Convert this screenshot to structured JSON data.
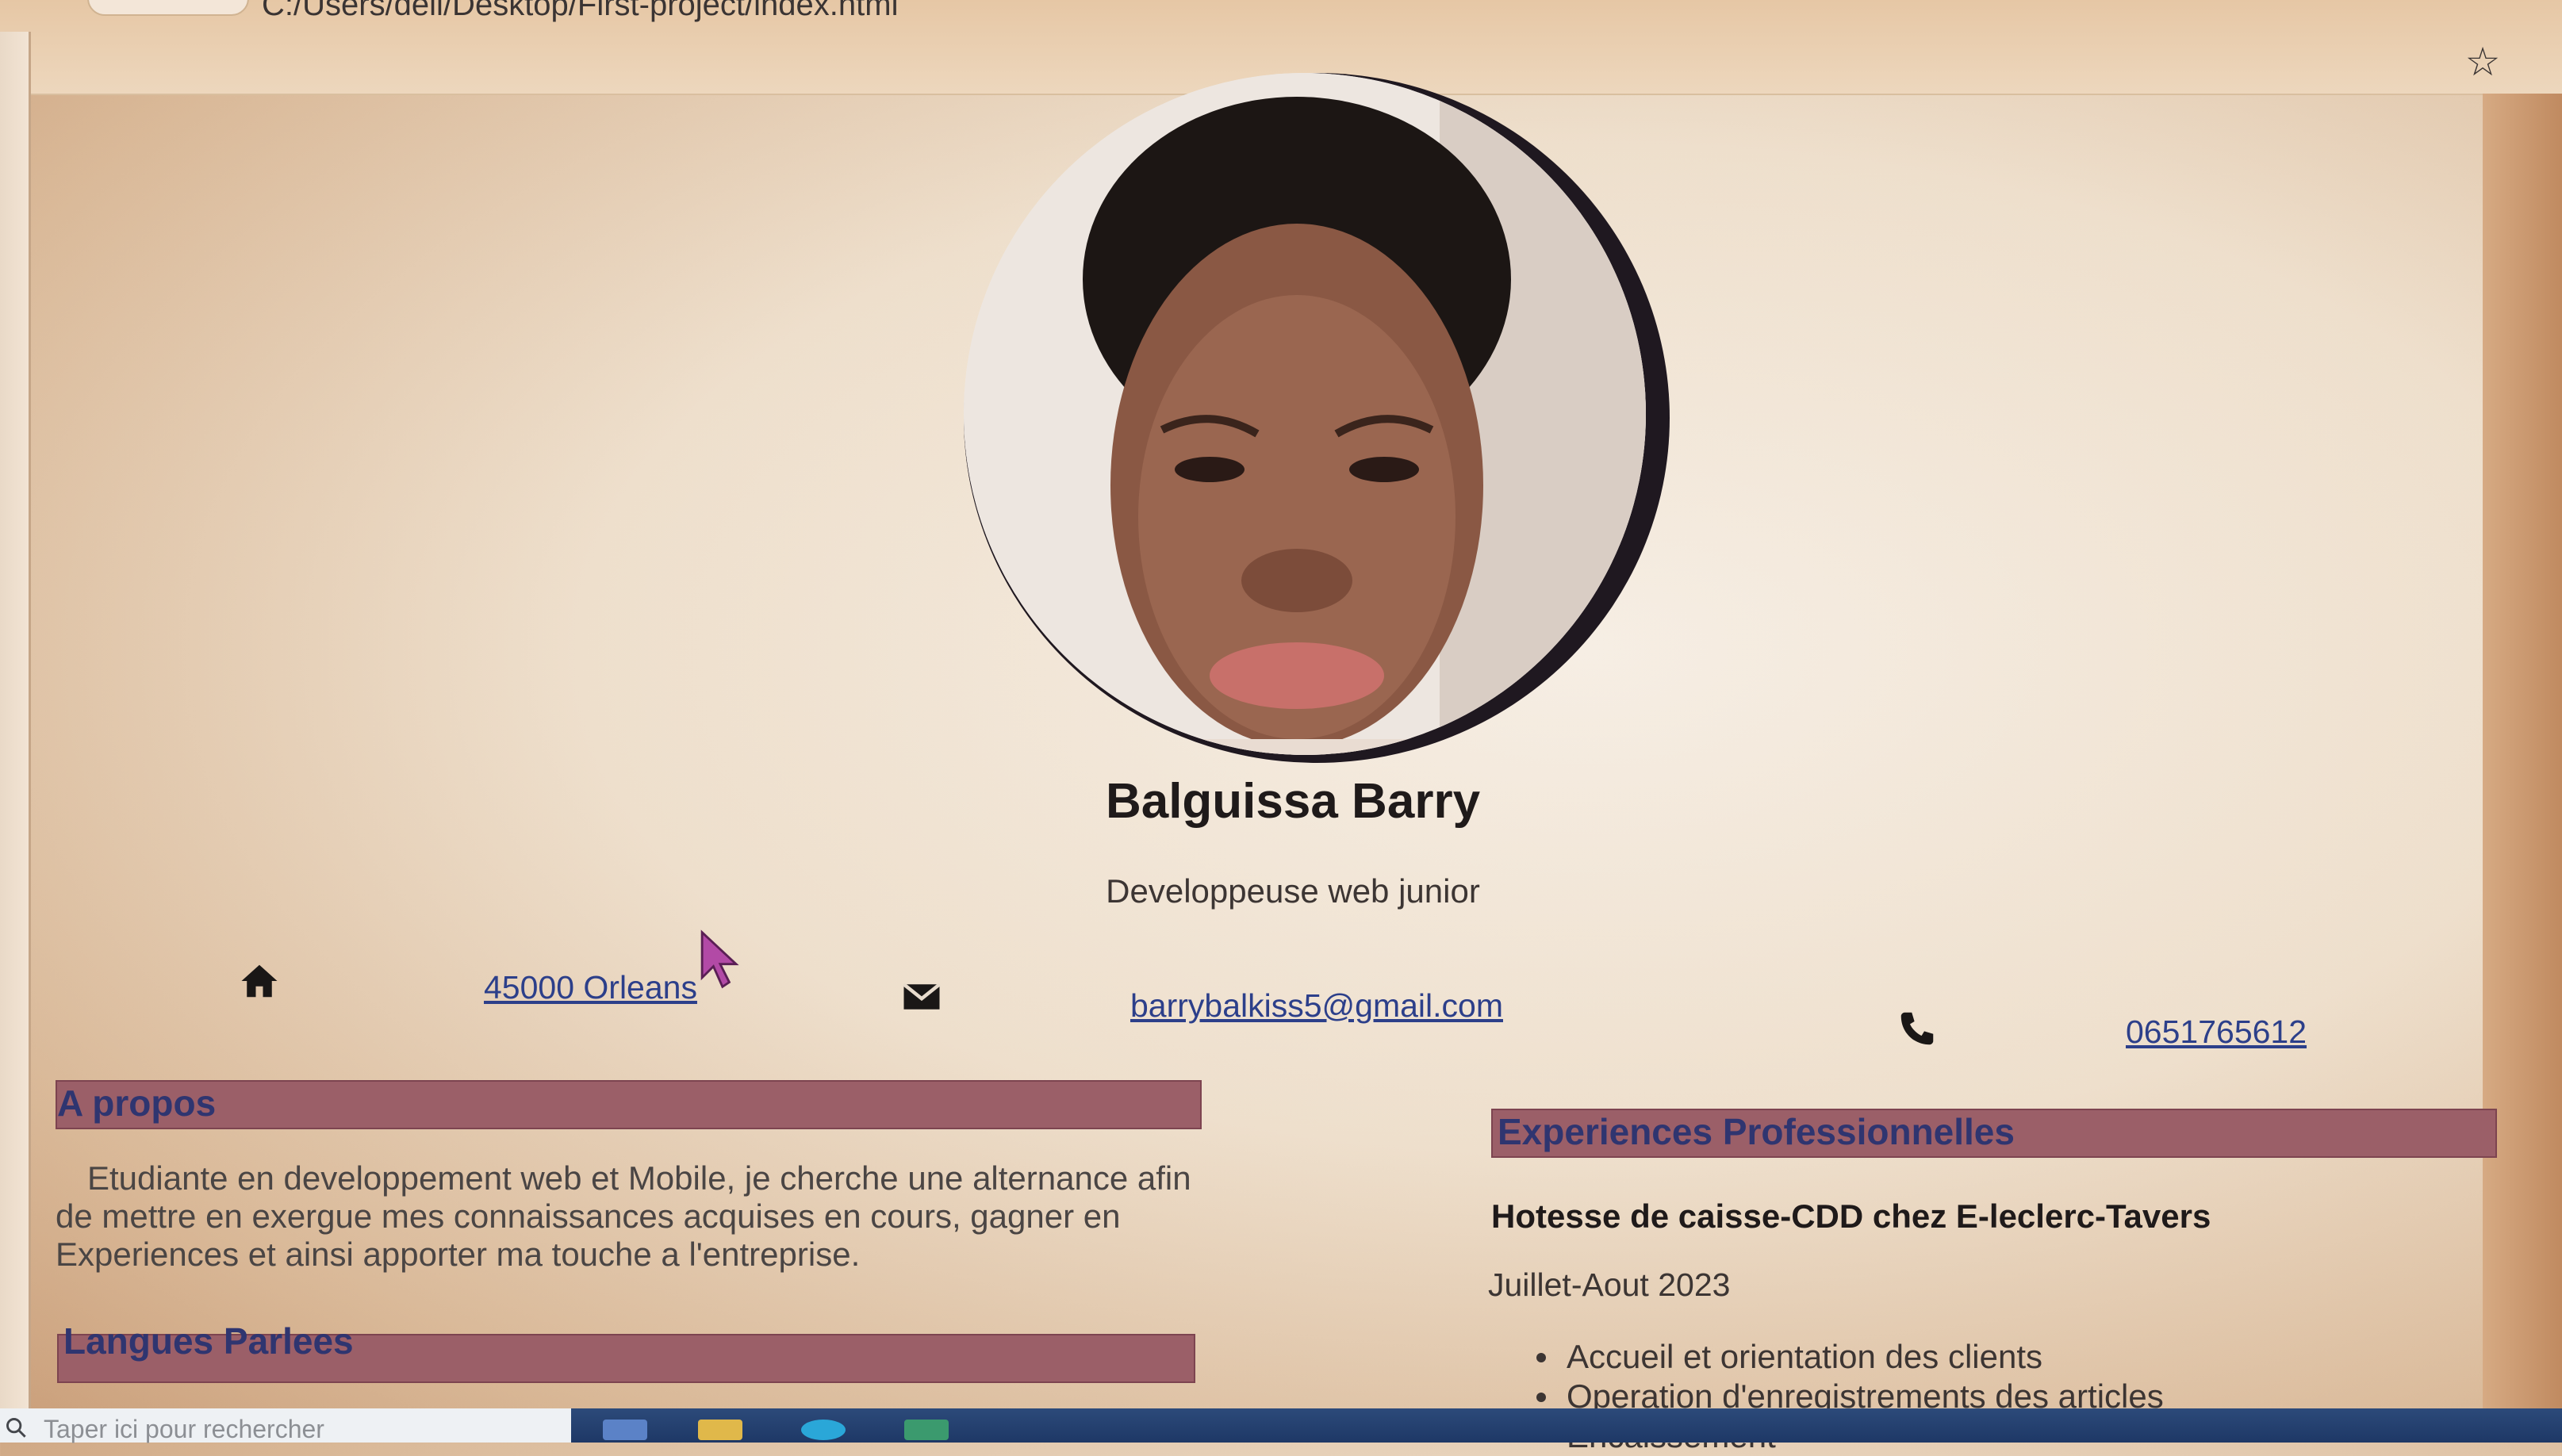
{
  "browser": {
    "url": "C:/Users/dell/Desktop/First-project/index.html",
    "bookmark_icon": "star-icon"
  },
  "profile": {
    "name": "Balguissa Barry",
    "job_title": "Developpeuse web junior",
    "photo_alt": "profile photo"
  },
  "contact": {
    "address": "45000 Orleans",
    "address_icon": "home-icon",
    "email": "barrybalkiss5@gmail.com",
    "email_icon": "envelope-icon",
    "phone": "0651765612",
    "phone_icon": "phone-icon"
  },
  "about": {
    "heading": "A propos",
    "text": "Etudiante en developpement web et Mobile, je cherche une alternance afin de mettre en exergue mes connaissances acquises en cours, gagner en Experiences et ainsi apporter ma touche a l'entreprise."
  },
  "languages": {
    "heading": "Langues Parlees"
  },
  "experience": {
    "heading": "Experiences Professionnelles",
    "items": [
      {
        "title": "Hotesse de caisse-CDD chez E-leclerc-Tavers",
        "date": "Juillet-Aout 2023",
        "duties": [
          "Accueil et orientation des clients",
          "Operation d'enregistrements des articles",
          "Encaissement"
        ]
      }
    ]
  },
  "taskbar": {
    "search_placeholder": "Taper ici pour rechercher"
  },
  "colors": {
    "section_bar": "#9b5f68",
    "section_title": "#2f3570",
    "link": "#2c3f8a"
  }
}
